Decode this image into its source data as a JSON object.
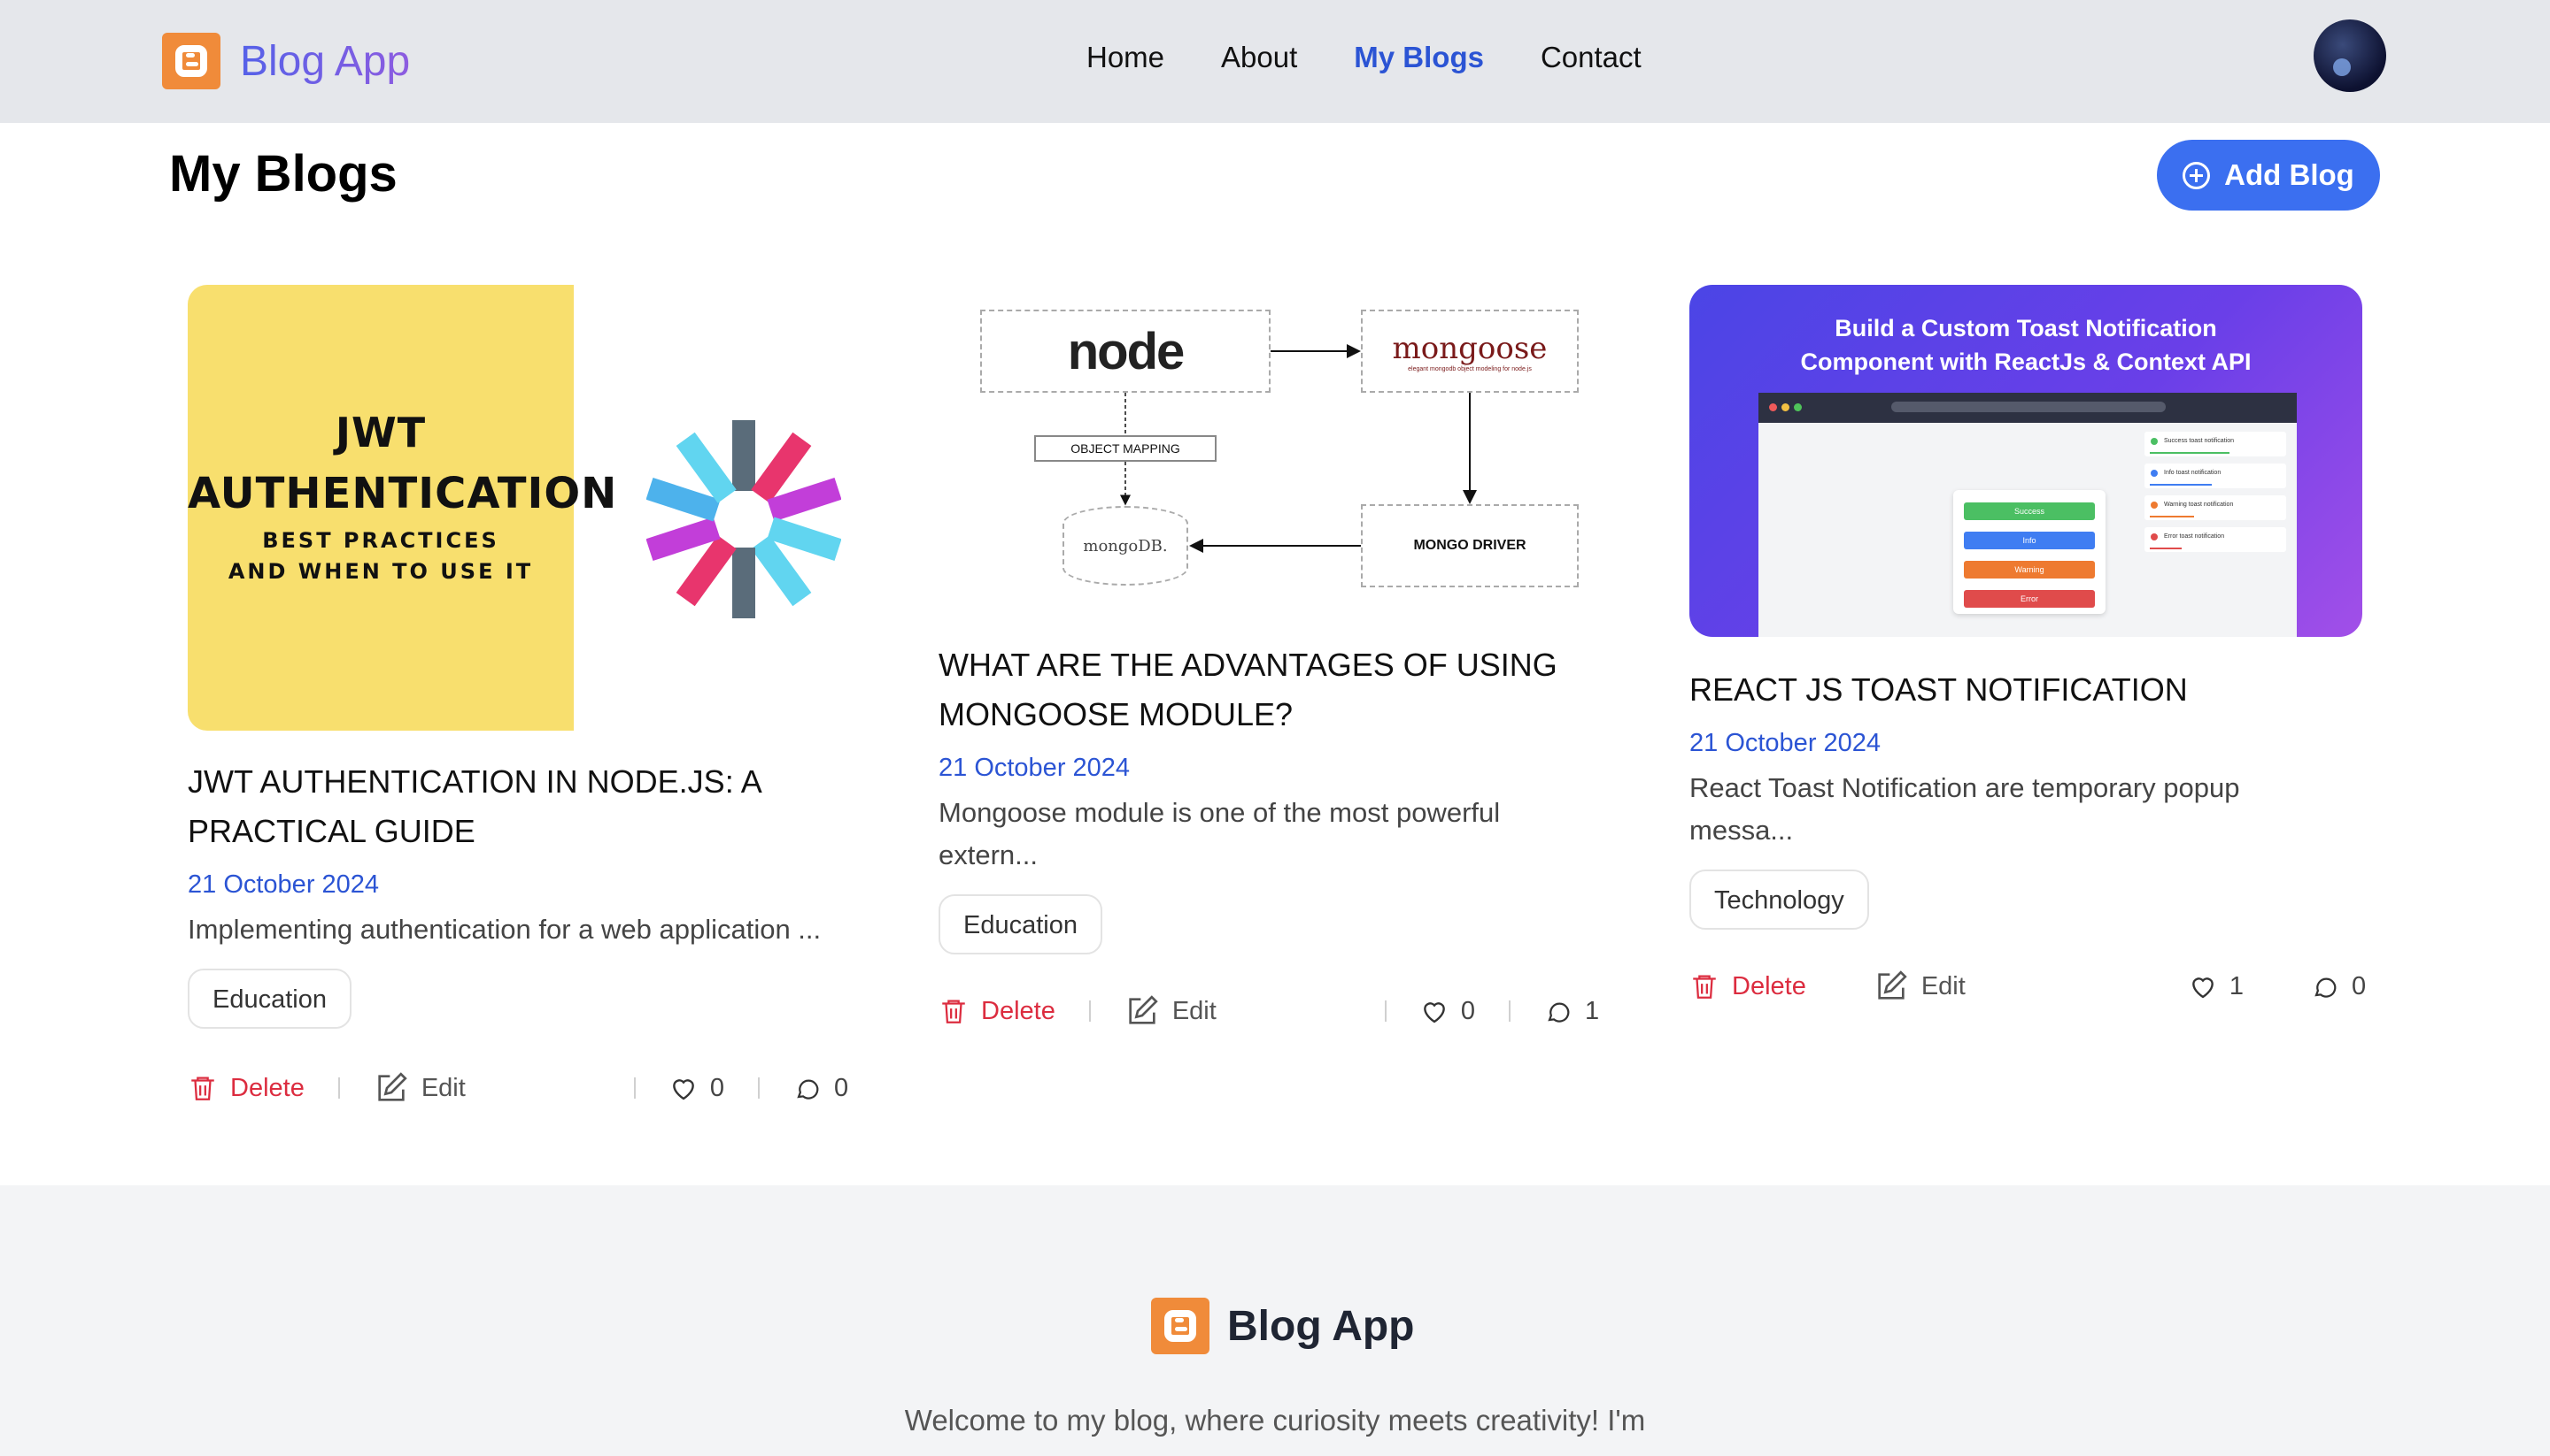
{
  "nav": {
    "brand": "Blog App",
    "links": [
      {
        "label": "Home"
      },
      {
        "label": "About"
      },
      {
        "label": "My Blogs"
      },
      {
        "label": "Contact"
      }
    ],
    "active_link": "My Blogs"
  },
  "page": {
    "title": "My Blogs",
    "add_button": "Add Blog"
  },
  "blogs": [
    {
      "image": {
        "line1": "JWT",
        "line2": "AUTHENTICATION",
        "line3": "BEST PRACTICES",
        "line4": "AND WHEN TO USE IT"
      },
      "title": "JWT AUTHENTICATION IN NODE.JS: A PRACTICAL GUIDE",
      "date": "21 October 2024",
      "excerpt": "Implementing authentication for a web application ...",
      "tag": "Education",
      "delete": "Delete",
      "edit": "Edit",
      "likes": "0",
      "comments": "0"
    },
    {
      "image": {
        "node": "node",
        "mongoose": "mongoose",
        "mongoose_sub": "elegant mongodb object modeling for node.js",
        "object_mapping": "OBJECT MAPPING",
        "mongodb": "mongoDB.",
        "driver": "MONGO DRIVER"
      },
      "title": "WHAT ARE THE ADVANTAGES OF USING MONGOOSE MODULE?",
      "date": "21 October 2024",
      "excerpt": "Mongoose module is one of the most powerful extern...",
      "tag": "Education",
      "delete": "Delete",
      "edit": "Edit",
      "likes": "0",
      "comments": "1"
    },
    {
      "image": {
        "title": "Build a Custom Toast Notification Component with ReactJs & Context API",
        "buttons": [
          "Success",
          "Info",
          "Warning",
          "Error"
        ],
        "notes": [
          "Success toast notification",
          "Info toast notification",
          "Warning toast notification",
          "Error toast notification"
        ]
      },
      "title": "REACT JS TOAST NOTIFICATION",
      "date": "21 October 2024",
      "excerpt": "React Toast Notification are temporary popup messa...",
      "tag": "Technology",
      "delete": "Delete",
      "edit": "Edit",
      "likes": "1",
      "comments": "0"
    }
  ],
  "footer": {
    "brand": "Blog App",
    "text": "Welcome to my blog, where curiosity meets creativity! I'm"
  },
  "colors": {
    "accent": "#3b6ff0",
    "link_active": "#2b54d4",
    "delete": "#dc2c3f",
    "brand_logo": "#f08b3a"
  }
}
